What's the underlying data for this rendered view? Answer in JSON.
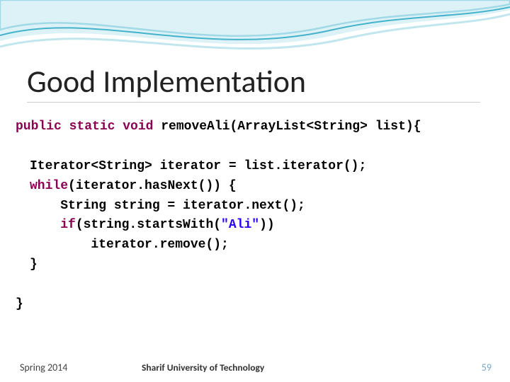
{
  "slide": {
    "title": "Good Implementation"
  },
  "code": {
    "l1_kw": "public static void",
    "l1_rest": " removeAli(ArrayList<String> list){",
    "l3_plain": "Iterator<String> iterator = list.iterator();",
    "l4_kw": "while",
    "l4_rest": "(iterator.hasNext()) {",
    "l5": "    String string = iterator.next();",
    "l6_kw": "    if",
    "l6_mid": "(string.startsWith(",
    "l6_str": "\"Ali\"",
    "l6_end": "))",
    "l7": "        iterator.remove();",
    "l8": "}",
    "l10": "}"
  },
  "footer": {
    "left": "Spring 2014",
    "center": "Sharif University of Technology",
    "page": "59"
  }
}
